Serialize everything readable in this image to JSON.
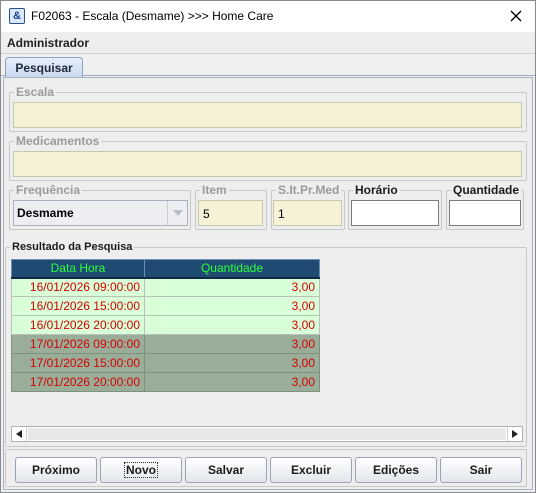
{
  "window": {
    "title": "F02063 - Escala (Desmame) >>> Home Care"
  },
  "user": {
    "role": "Administrador"
  },
  "tabs": [
    {
      "label": "Pesquisar"
    }
  ],
  "form": {
    "escala": {
      "label": "Escala",
      "value": ""
    },
    "medicamentos": {
      "label": "Medicamentos",
      "value": ""
    },
    "frequencia": {
      "label": "Frequência",
      "value": "Desmame"
    },
    "item": {
      "label": "Item",
      "value": "5"
    },
    "sitprmed": {
      "label": "S.It.Pr.Med",
      "value": "1"
    },
    "horario": {
      "label": "Horário",
      "value": ""
    },
    "quantidade": {
      "label": "Quantidade",
      "value": ""
    }
  },
  "results": {
    "label": "Resultado da Pesquisa",
    "columns": [
      "Data Hora",
      "Quantidade"
    ],
    "rows": [
      {
        "datetime": "16/01/2026 09:00:00",
        "qty": "3,00",
        "shade": "light"
      },
      {
        "datetime": "16/01/2026 15:00:00",
        "qty": "3,00",
        "shade": "light"
      },
      {
        "datetime": "16/01/2026 20:00:00",
        "qty": "3,00",
        "shade": "light"
      },
      {
        "datetime": "17/01/2026 09:00:00",
        "qty": "3,00",
        "shade": "dark"
      },
      {
        "datetime": "17/01/2026 15:00:00",
        "qty": "3,00",
        "shade": "dark"
      },
      {
        "datetime": "17/01/2026 20:00:00",
        "qty": "3,00",
        "shade": "dark"
      }
    ]
  },
  "buttons": {
    "proximo": "Próximo",
    "novo": "Novo",
    "salvar": "Salvar",
    "excluir": "Excluir",
    "edicoes": "Edições",
    "sair": "Sair"
  },
  "colors": {
    "header_bg": "#1f4b72",
    "header_text": "#2bff3a",
    "row_text": "#d40000",
    "row_light": "#d8ffd8",
    "row_dark": "#99ad99",
    "readonly_field": "#f5f2d8"
  },
  "icons": {
    "app": "app-icon",
    "close": "close-icon",
    "combo_arrow": "chevron-down-icon",
    "scroll_left": "scroll-left-icon",
    "scroll_right": "scroll-right-icon"
  }
}
